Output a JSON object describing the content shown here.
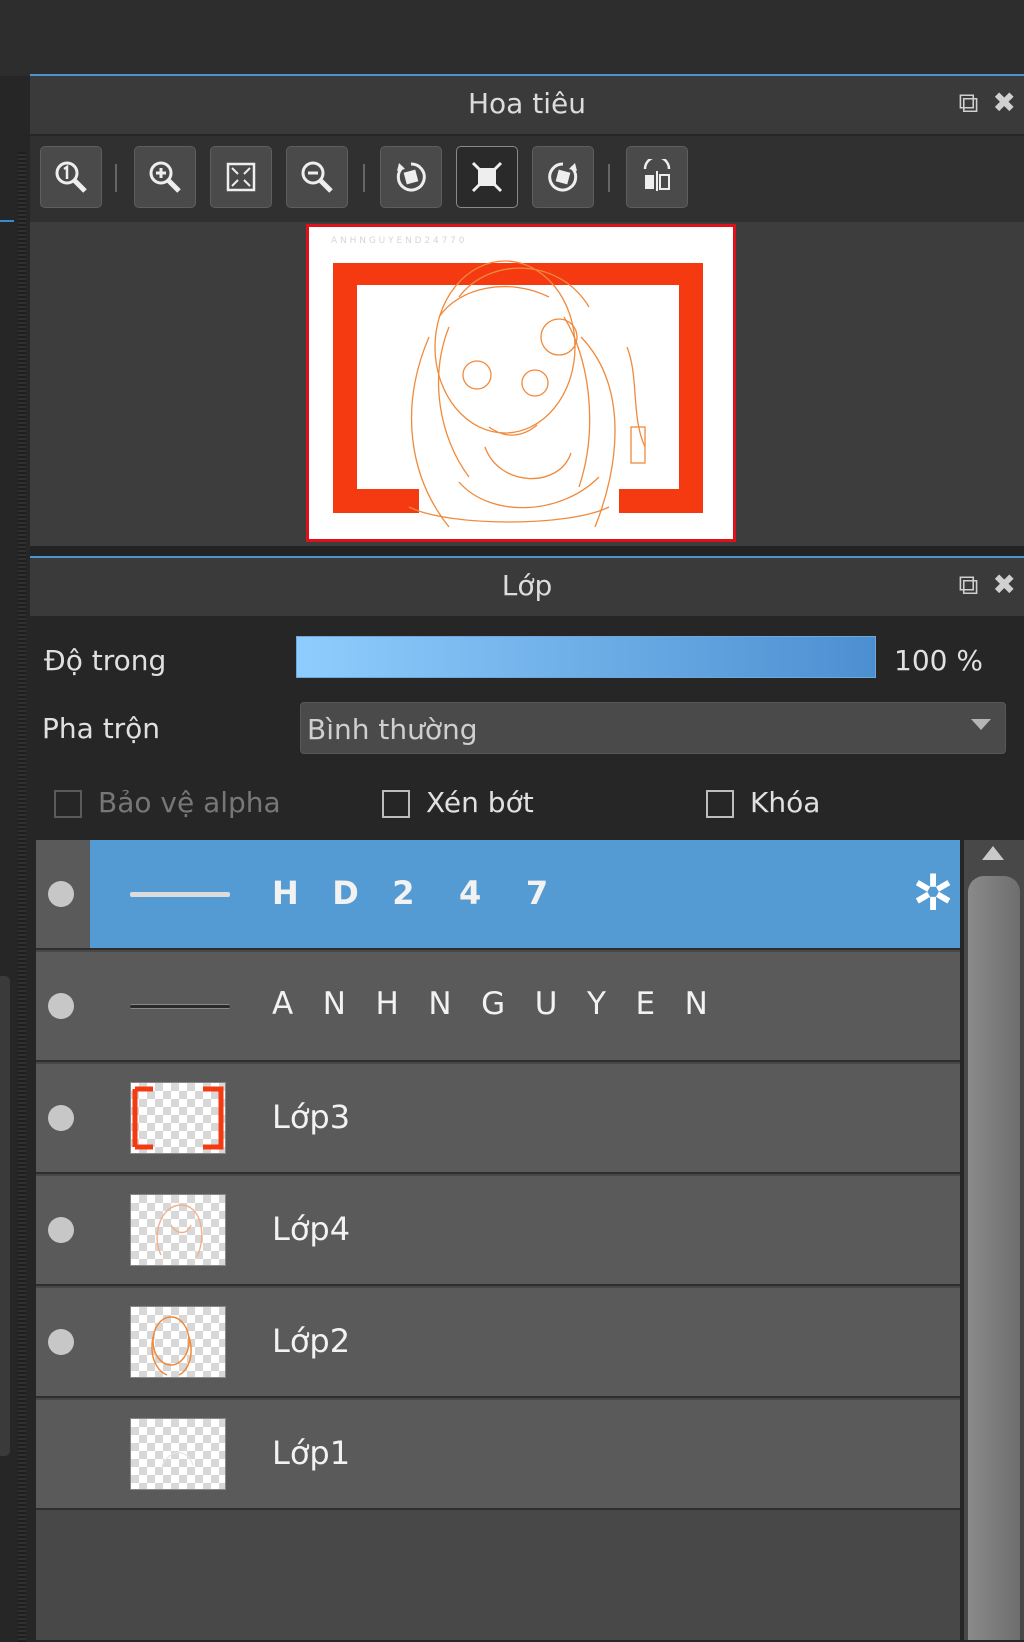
{
  "navigator": {
    "title": "Hoa tiêu",
    "title_icons": {
      "popout": "⧉",
      "close": "✖"
    }
  },
  "layers_panel": {
    "title": "Lớp",
    "title_icons": {
      "popout": "⧉",
      "close": "✖"
    },
    "opacity": {
      "label": "Độ trong",
      "value": "100 %",
      "level_percent": 100
    },
    "blend": {
      "label": "Pha trộn",
      "value": "Bình thường"
    },
    "checkboxes": {
      "protect_alpha": {
        "label": "Bảo vệ alpha",
        "checked": false,
        "disabled": true
      },
      "clipping": {
        "label": "Xén bớt",
        "checked": false
      },
      "lock": {
        "label": "Khóa",
        "checked": false
      }
    },
    "layers": [
      {
        "name": "H   D   2    4    7",
        "visible": true,
        "selected": true
      },
      {
        "name": "A   N   H   N   G   U   Y   E   N",
        "visible": true,
        "selected": false
      },
      {
        "name": "Lớp3",
        "visible": true,
        "selected": false
      },
      {
        "name": "Lớp4",
        "visible": true,
        "selected": false
      },
      {
        "name": "Lớp2",
        "visible": true,
        "selected": false
      },
      {
        "name": "Lớp1",
        "visible": false,
        "selected": false
      }
    ]
  },
  "colors": {
    "accent": "#4f93cf",
    "selected_row": "#549ad3",
    "frame_red": "#e0101a",
    "sketch_orange": "#f28a3a"
  }
}
